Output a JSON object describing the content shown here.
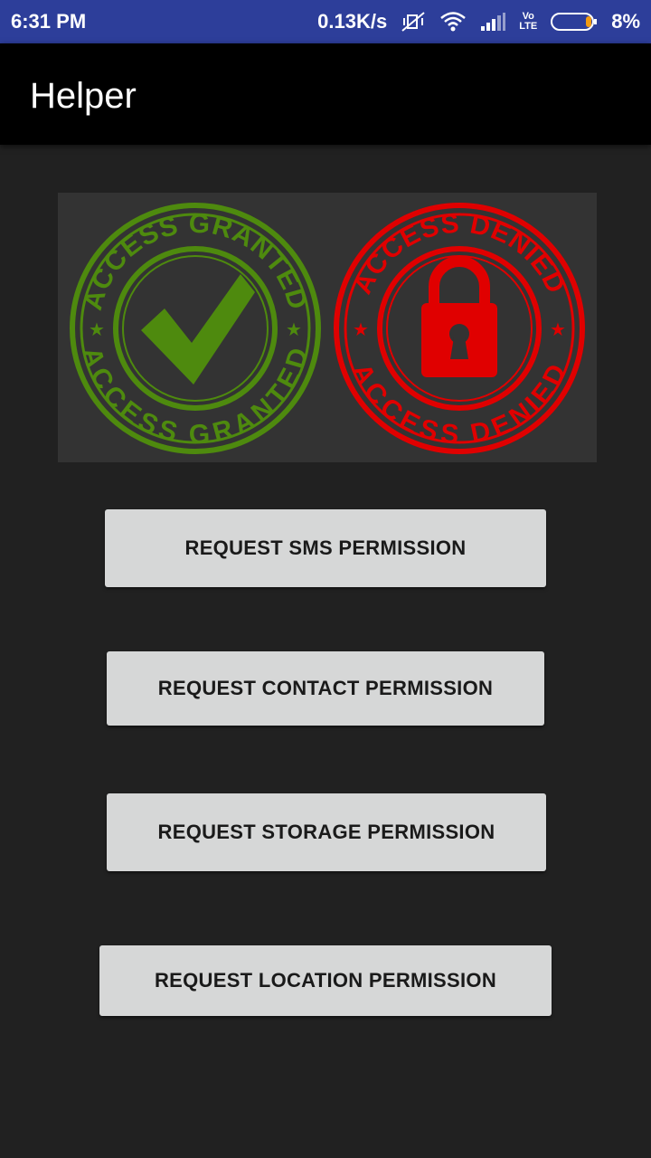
{
  "status_bar": {
    "time": "6:31 PM",
    "network_speed": "0.13K/s",
    "battery_percent": "8%",
    "lte_top": "Vo",
    "lte_bottom": "LTE",
    "icons": [
      "mute-vibrate-icon",
      "wifi-icon",
      "cell-signal-icon",
      "volte-icon",
      "battery-icon"
    ]
  },
  "app_bar": {
    "title": "Helper"
  },
  "banner": {
    "granted_text": "ACCESS GRANTED",
    "denied_text": "ACCESS DENIED",
    "granted_color": "#4e8a0e",
    "denied_color": "#e00000"
  },
  "buttons": {
    "sms": "REQUEST SMS PERMISSION",
    "contact": "REQUEST CONTACT PERMISSION",
    "storage": "REQUEST STORAGE PERMISSION",
    "location": "REQUEST LOCATION PERMISSION"
  }
}
